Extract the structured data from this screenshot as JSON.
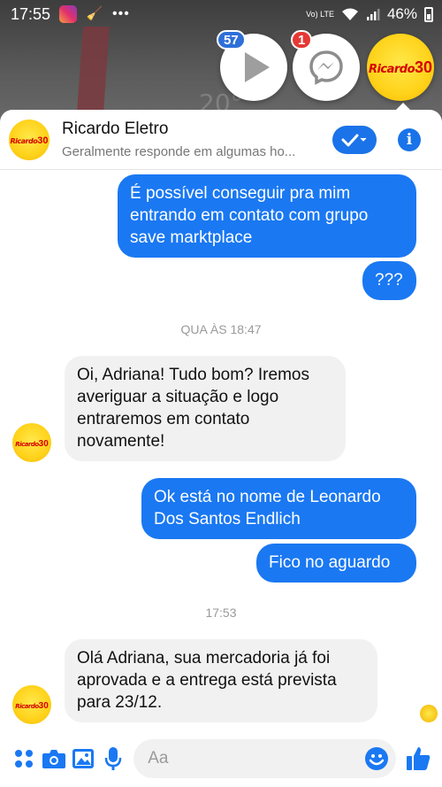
{
  "status_bar": {
    "time": "17:55",
    "network": "Vo) LTE",
    "battery_percent": "46%"
  },
  "chat_heads": {
    "play_badge": "57",
    "messenger_badge": "1"
  },
  "header": {
    "name": "Ricardo Eletro",
    "subtitle": "Geralmente responde em algumas ho..."
  },
  "logo": {
    "text": "Ricardo",
    "number": "30"
  },
  "messages": [
    {
      "from": "me",
      "text": "É possível conseguir pra mim entrando em contato com grupo save marktplace"
    },
    {
      "from": "me",
      "text": "???"
    },
    {
      "from": "them",
      "text": "Oi, Adriana! Tudo bom? Iremos averiguar a situação e logo entraremos em contato novamente!"
    },
    {
      "from": "me",
      "text": "Ok está no nome de Leonardo Dos Santos Endlich"
    },
    {
      "from": "me",
      "text": "Fico no aguardo"
    },
    {
      "from": "them",
      "text": "Olá Adriana, sua mercadoria já foi aprovada e a entrega está prevista para 23/12."
    }
  ],
  "timestamps": [
    "QUA ÀS 18:47",
    "17:53"
  ],
  "composer": {
    "placeholder": "Aa"
  },
  "colors": {
    "accent": "#1a78f2",
    "incoming": "#f1f1f1",
    "brand_yellow": "#ffd21a",
    "brand_red": "#d40000"
  }
}
